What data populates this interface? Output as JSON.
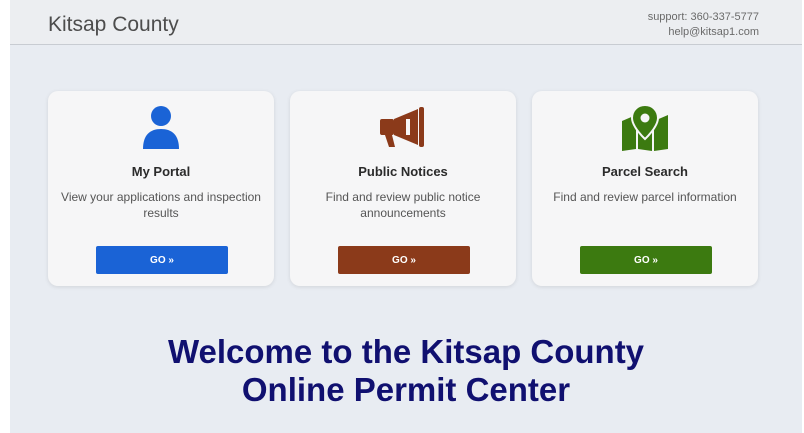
{
  "header": {
    "brand": "Kitsap County",
    "support_phone": "support: 360-337-5777",
    "support_email": "help@kitsap1.com"
  },
  "cards": [
    {
      "title": "My Portal",
      "desc_line1": "View your applications and inspection",
      "desc_line2": "results",
      "button": "GO »",
      "icon": "user-icon",
      "color": "#1a63d6"
    },
    {
      "title": "Public Notices",
      "desc_line1": "Find and review public notice",
      "desc_line2": "announcements",
      "button": "GO »",
      "icon": "megaphone-icon",
      "color": "#8b3a1a"
    },
    {
      "title": "Parcel Search",
      "desc_line1": "Find and review parcel information",
      "desc_line2": "",
      "button": "GO »",
      "icon": "map-pin-icon",
      "color": "#3c7a10"
    }
  ],
  "welcome": {
    "line1": "Welcome to the Kitsap County",
    "line2": "Online Permit Center"
  }
}
